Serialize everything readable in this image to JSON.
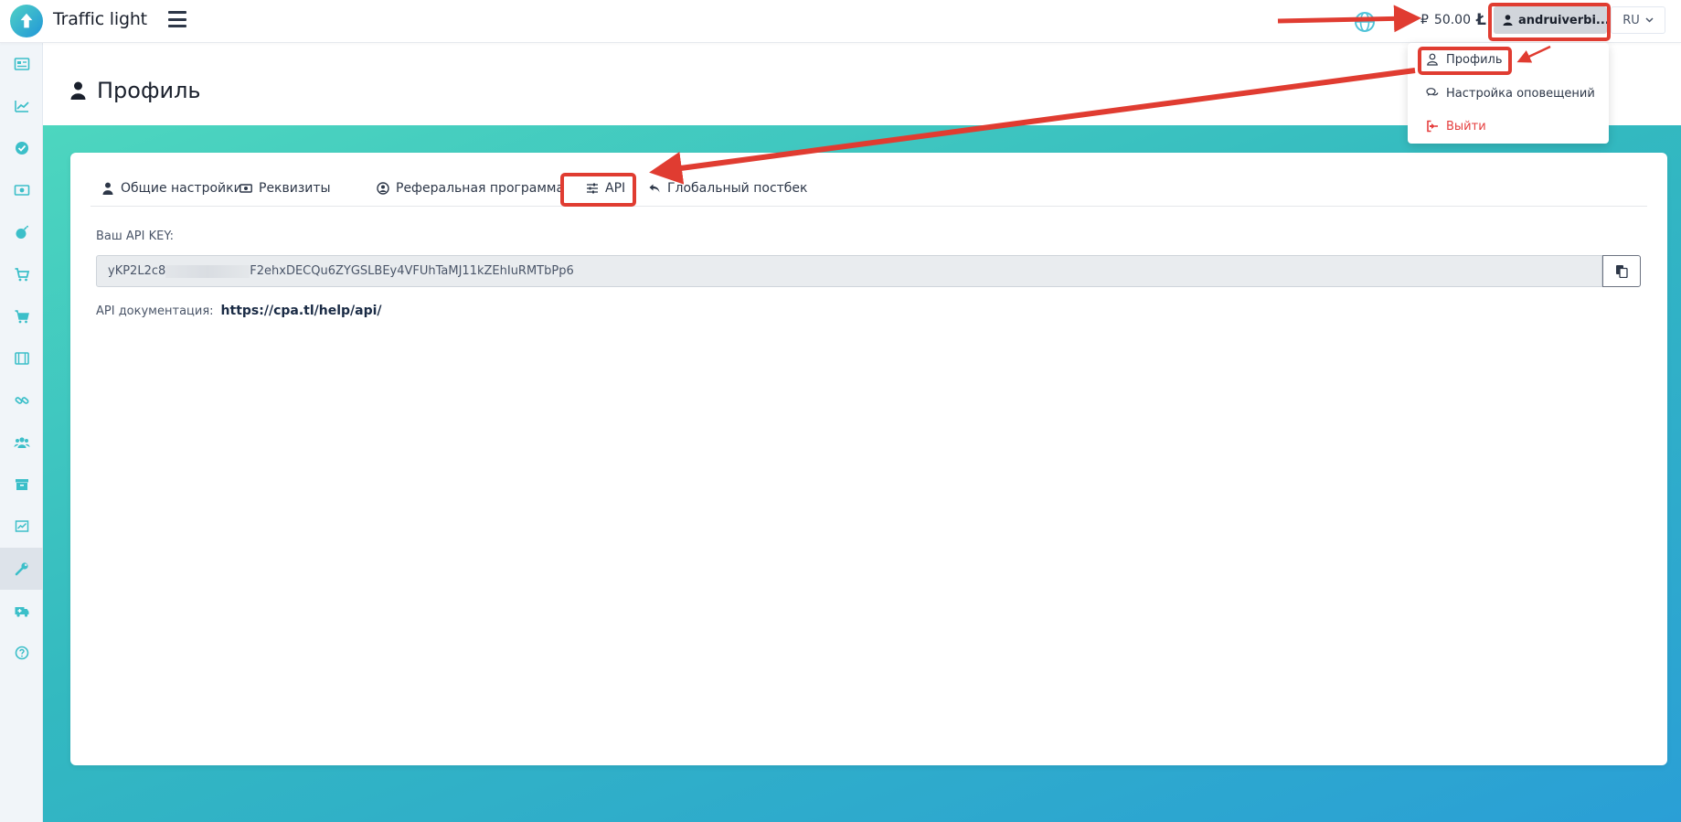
{
  "app": {
    "brand": "Traffic light"
  },
  "topbar": {
    "balance_amount": "50.00",
    "balance_currency": "₽",
    "balance_unit": "Ł",
    "user_name": "andruiverbi...",
    "language": "RU"
  },
  "user_menu": {
    "items": [
      {
        "label": "Профиль",
        "icon": "user-outline-icon"
      },
      {
        "label": "Настройка оповещений",
        "icon": "chat-bubbles-icon"
      },
      {
        "label": "Выйти",
        "icon": "logout-icon"
      }
    ]
  },
  "sidebar": {
    "items": [
      {
        "icon": "dashboard-card-icon",
        "active": false
      },
      {
        "icon": "chart-line-icon",
        "active": false
      },
      {
        "icon": "check-circle-icon",
        "active": false
      },
      {
        "icon": "money-bill-icon",
        "active": false
      },
      {
        "icon": "bomb-icon",
        "active": false
      },
      {
        "icon": "cart-icon",
        "active": false
      },
      {
        "icon": "cart-alt-icon",
        "active": false
      },
      {
        "icon": "film-icon",
        "active": false
      },
      {
        "icon": "link-icon",
        "active": false
      },
      {
        "icon": "users-icon",
        "active": false
      },
      {
        "icon": "archive-icon",
        "active": false
      },
      {
        "icon": "analytics-icon",
        "active": false
      },
      {
        "icon": "wrench-icon",
        "active": true
      },
      {
        "icon": "ambulance-icon",
        "active": false
      },
      {
        "icon": "help-circle-icon",
        "active": false
      }
    ]
  },
  "page": {
    "title": "Профиль"
  },
  "tabs": [
    {
      "label": "Общие настройки",
      "icon": "user-icon"
    },
    {
      "label": "Реквизиты",
      "icon": "money-icon"
    },
    {
      "label": "Реферальная программа",
      "icon": "user-circle-icon"
    },
    {
      "label": "API",
      "icon": "sliders-icon",
      "active": true
    },
    {
      "label": "Глобальный постбек",
      "icon": "reply-icon"
    }
  ],
  "api": {
    "key_label": "Ваш API KEY:",
    "key_prefix": "yKP2L2c8",
    "key_suffix": "F2ehxDECQu6ZYGSLBEy4VFUhTaMJ11kZEhIuRMTbPp6",
    "doc_label": "API документация:",
    "doc_link": "https://cpa.tl/help/api/"
  },
  "colors": {
    "accent": "#2a9fd6",
    "gradient_start": "#4dd6bf",
    "annotation": "#e03c31",
    "logout": "#e53e3e"
  }
}
